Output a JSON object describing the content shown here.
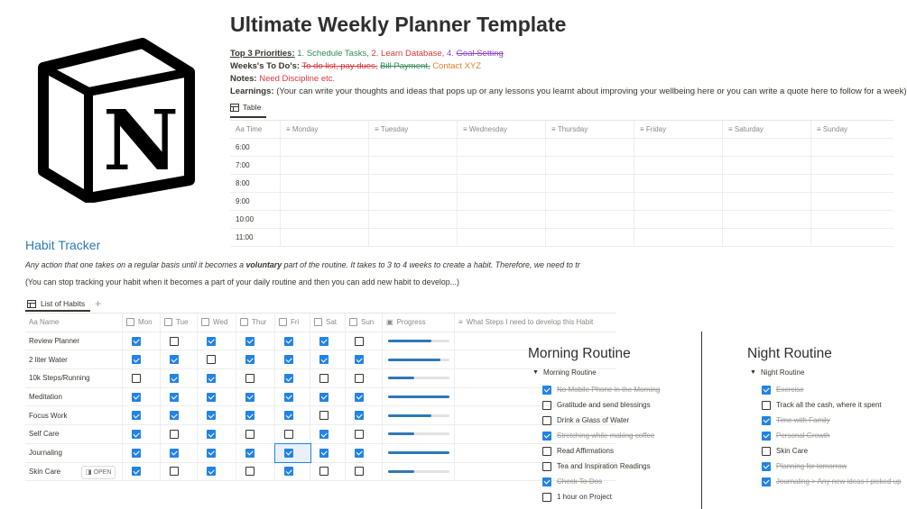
{
  "page": {
    "title": "Ultimate Weekly Planner Template",
    "priorities": {
      "label": "Top 3 Priorities:",
      "items": [
        "1. Schedule Tasks,",
        "2. Learn Database,",
        "4.",
        "Goal Setting"
      ]
    },
    "todos": {
      "label": "Weeks's To Do's:",
      "items": [
        "To do list, pay dues,",
        "Bill Payment,",
        "Contact XYZ"
      ]
    },
    "notes": {
      "label": "Notes:",
      "value": "Need Discipline etc."
    },
    "learnings": {
      "label": "Learnings:",
      "value": "(Your can write your thoughts and ideas that pops up or any lessons you learnt about improving your wellbeing here or you can write a quote here to follow for a week)"
    }
  },
  "weekly_table": {
    "tab_label": "Table",
    "headers": [
      "Aa Time",
      "Monday",
      "Tuesday",
      "Wednesday",
      "Thursday",
      "Friday",
      "Saturday",
      "Sunday"
    ],
    "times": [
      "6:00",
      "7:00",
      "8:00",
      "9:00",
      "10:00",
      "11:00"
    ]
  },
  "habit_tracker": {
    "title": "Habit Tracker",
    "desc_pre": "Any action that one takes on a regular basis until it becomes a ",
    "desc_bold": "voluntary",
    "desc_post": " part of the routine. It takes to 3 to 4 weeks to create a habit. Therefore, we need to tr",
    "note": "(You can stop tracking your habit when it becomes a part of your daily routine and then you can add new habit to develop...)",
    "tab_label": "List of Habits",
    "add_symbol": "+",
    "open_label": "OPEN",
    "headers": [
      "Aa Name",
      "Mon",
      "Tue",
      "Wed",
      "Thur",
      "Fri",
      "Sat",
      "Sun",
      "Progress",
      "What Steps I need to develop this Habit"
    ],
    "rows": [
      {
        "name": "Review Planner",
        "days": [
          true,
          false,
          true,
          true,
          true,
          true,
          false
        ],
        "progress": 0.71
      },
      {
        "name": "2 liter Water",
        "days": [
          true,
          true,
          false,
          true,
          true,
          true,
          true
        ],
        "progress": 0.86
      },
      {
        "name": "10k Steps/Running",
        "days": [
          false,
          true,
          true,
          false,
          true,
          false,
          false
        ],
        "progress": 0.43
      },
      {
        "name": "Meditation",
        "days": [
          true,
          true,
          true,
          true,
          true,
          true,
          true
        ],
        "progress": 1.0
      },
      {
        "name": "Focus Work",
        "days": [
          true,
          true,
          true,
          true,
          true,
          false,
          true
        ],
        "progress": 0.71
      },
      {
        "name": "Self Care",
        "days": [
          true,
          false,
          true,
          false,
          false,
          true,
          false
        ],
        "progress": 0.43
      },
      {
        "name": "Journaling",
        "days": [
          true,
          true,
          true,
          true,
          true,
          true,
          true
        ],
        "progress": 1.0
      },
      {
        "name": "Skin Care",
        "days": [
          true,
          false,
          true,
          false,
          true,
          false,
          false
        ],
        "progress": 0.43
      }
    ]
  },
  "morning_routine": {
    "title": "Morning Routine",
    "toggle": "Morning Routine",
    "items": [
      {
        "text": "No Mobile Phone in the Morning",
        "done": true
      },
      {
        "text": "Gratitude and send blessings",
        "done": false
      },
      {
        "text": "Drink a Glass of Water",
        "done": false
      },
      {
        "text": "Stretching while making coffee",
        "done": true
      },
      {
        "text": "Read Affirmations",
        "done": false
      },
      {
        "text": "Tea and Inspiration Readings",
        "done": false
      },
      {
        "text": "Check To-Dos",
        "done": true
      },
      {
        "text": "1 hour on Project",
        "done": false
      }
    ]
  },
  "night_routine": {
    "title": "Night Routine",
    "toggle": "Night Routine",
    "items": [
      {
        "text": "Exercise",
        "done": true
      },
      {
        "text": "Track all the cash, where it spent",
        "done": false
      },
      {
        "text": "Time with Family",
        "done": true
      },
      {
        "text": "Personal Growth",
        "done": true
      },
      {
        "text": "Skin Care",
        "done": false
      },
      {
        "text": "Planning for tomorrow",
        "done": true
      },
      {
        "text": "Journaling > Any new ideas I picked up",
        "done": true
      }
    ]
  },
  "logo": {
    "letter": "N",
    "icon": "notion-logo"
  },
  "colors": {
    "accent": "#2383e2",
    "heading_blue": "#2f78b7",
    "green": "#2e8b57",
    "red": "#d9373d",
    "purple": "#9147c7",
    "orange": "#d9822b"
  }
}
